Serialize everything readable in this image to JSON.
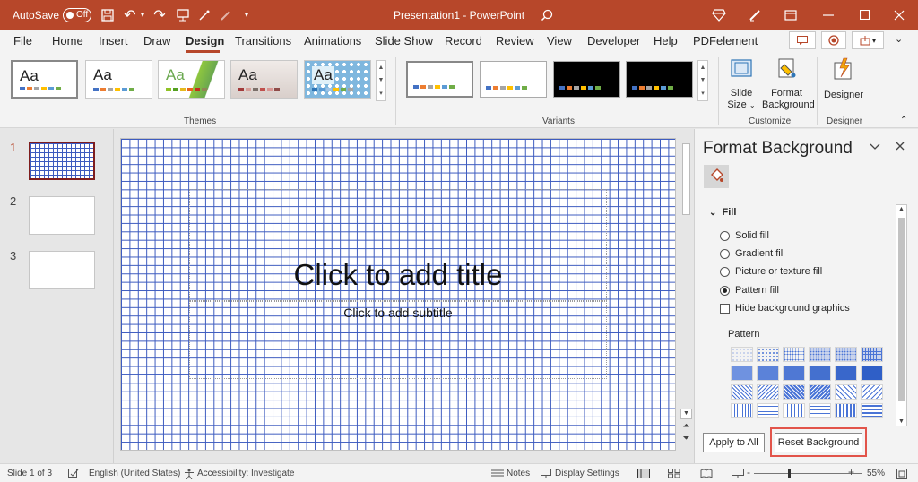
{
  "titlebar": {
    "autosave_label": "AutoSave",
    "autosave_state": "Off",
    "document_title": "Presentation1 - PowerPoint",
    "bg_color": "#b7472a",
    "icons": [
      "save-icon",
      "undo-icon",
      "redo-icon",
      "presenter-icon",
      "magic-wand-icon",
      "pen-icon",
      "dropdown-icon",
      "search-icon",
      "diamond-icon",
      "pen-edit-icon",
      "restore-icon",
      "minimize-icon",
      "maximize-icon",
      "close-icon"
    ]
  },
  "menu": {
    "tabs": [
      "File",
      "Home",
      "Insert",
      "Draw",
      "Design",
      "Transitions",
      "Animations",
      "Slide Show",
      "Record",
      "Review",
      "View",
      "Developer",
      "Help",
      "PDFelement"
    ],
    "active": "Design"
  },
  "ribbon": {
    "themes_label": "Themes",
    "variants_label": "Variants",
    "customize_label": "Customize",
    "designer_group_label": "Designer",
    "theme_sample": "Aa",
    "slide_size_line1": "Slide",
    "slide_size_line2": "Size",
    "format_bg_line1": "Format",
    "format_bg_line2": "Background",
    "designer_label": "Designer"
  },
  "slides": {
    "numbers": [
      "1",
      "2",
      "3"
    ],
    "title_placeholder": "Click to add title",
    "subtitle_placeholder": "Click to add subtitle"
  },
  "pane": {
    "title": "Format Background",
    "fill_header": "Fill",
    "options": [
      "Solid fill",
      "Gradient fill",
      "Picture or texture fill",
      "Pattern fill"
    ],
    "selected_option": "Pattern fill",
    "hide_graphics": "Hide background graphics",
    "pattern_label": "Pattern",
    "apply_all": "Apply to All",
    "reset_background": "Reset Background",
    "highlight_color": "#e2544a"
  },
  "status": {
    "slide_info": "Slide 1 of 3",
    "language": "English (United States)",
    "accessibility": "Accessibility: Investigate",
    "notes": "Notes",
    "display_settings": "Display Settings",
    "zoom": "55%",
    "zoom_minus": "-",
    "zoom_plus": "+"
  }
}
